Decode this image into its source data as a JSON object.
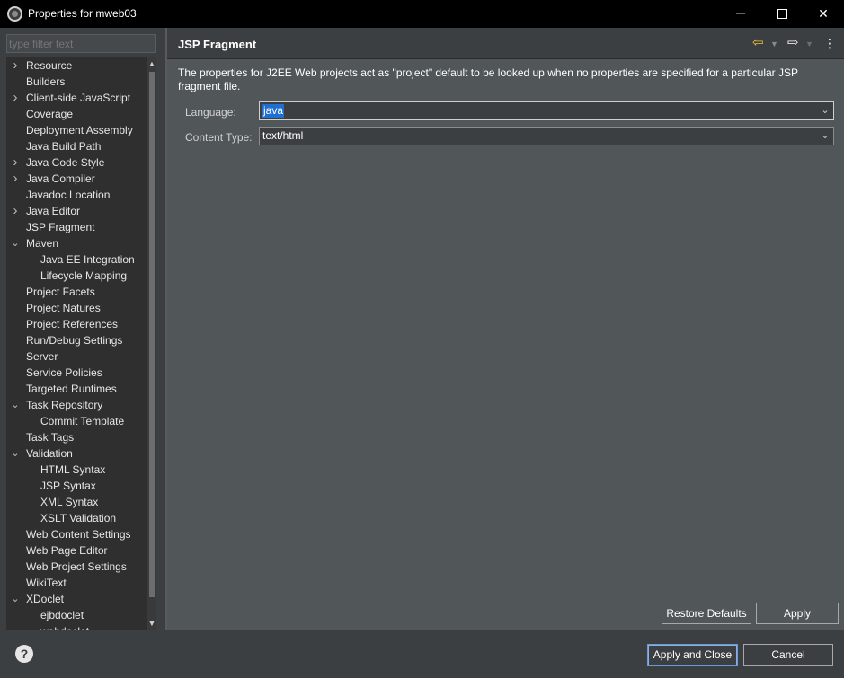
{
  "window": {
    "title": "Properties for mweb03",
    "app_icon": "eclipse-icon",
    "controls": [
      "minimize-icon",
      "maximize-icon",
      "close-icon"
    ]
  },
  "sidebar": {
    "filter_placeholder": "type filter text",
    "items": [
      {
        "label": "Resource",
        "level": 0,
        "toggle": "collapsed"
      },
      {
        "label": "Builders",
        "level": 0,
        "toggle": "none"
      },
      {
        "label": "Client-side JavaScript",
        "level": 0,
        "toggle": "collapsed"
      },
      {
        "label": "Coverage",
        "level": 0,
        "toggle": "none"
      },
      {
        "label": "Deployment Assembly",
        "level": 0,
        "toggle": "none"
      },
      {
        "label": "Java Build Path",
        "level": 0,
        "toggle": "none"
      },
      {
        "label": "Java Code Style",
        "level": 0,
        "toggle": "collapsed"
      },
      {
        "label": "Java Compiler",
        "level": 0,
        "toggle": "collapsed"
      },
      {
        "label": "Javadoc Location",
        "level": 0,
        "toggle": "none"
      },
      {
        "label": "Java Editor",
        "level": 0,
        "toggle": "collapsed"
      },
      {
        "label": "JSP Fragment",
        "level": 0,
        "toggle": "none"
      },
      {
        "label": "Maven",
        "level": 0,
        "toggle": "expanded"
      },
      {
        "label": "Java EE Integration",
        "level": 1,
        "toggle": "none"
      },
      {
        "label": "Lifecycle Mapping",
        "level": 1,
        "toggle": "none"
      },
      {
        "label": "Project Facets",
        "level": 0,
        "toggle": "none"
      },
      {
        "label": "Project Natures",
        "level": 0,
        "toggle": "none"
      },
      {
        "label": "Project References",
        "level": 0,
        "toggle": "none"
      },
      {
        "label": "Run/Debug Settings",
        "level": 0,
        "toggle": "none"
      },
      {
        "label": "Server",
        "level": 0,
        "toggle": "none"
      },
      {
        "label": "Service Policies",
        "level": 0,
        "toggle": "none"
      },
      {
        "label": "Targeted Runtimes",
        "level": 0,
        "toggle": "none"
      },
      {
        "label": "Task Repository",
        "level": 0,
        "toggle": "expanded"
      },
      {
        "label": "Commit Template",
        "level": 1,
        "toggle": "none"
      },
      {
        "label": "Task Tags",
        "level": 0,
        "toggle": "none"
      },
      {
        "label": "Validation",
        "level": 0,
        "toggle": "expanded"
      },
      {
        "label": "HTML Syntax",
        "level": 1,
        "toggle": "none"
      },
      {
        "label": "JSP Syntax",
        "level": 1,
        "toggle": "none"
      },
      {
        "label": "XML Syntax",
        "level": 1,
        "toggle": "none"
      },
      {
        "label": "XSLT Validation",
        "level": 1,
        "toggle": "none"
      },
      {
        "label": "Web Content Settings",
        "level": 0,
        "toggle": "none"
      },
      {
        "label": "Web Page Editor",
        "level": 0,
        "toggle": "none"
      },
      {
        "label": "Web Project Settings",
        "level": 0,
        "toggle": "none"
      },
      {
        "label": "WikiText",
        "level": 0,
        "toggle": "none"
      },
      {
        "label": "XDoclet",
        "level": 0,
        "toggle": "expanded"
      },
      {
        "label": "ejbdoclet",
        "level": 1,
        "toggle": "none"
      },
      {
        "label": "webdoclet",
        "level": 1,
        "toggle": "none"
      }
    ]
  },
  "page": {
    "title": "JSP Fragment",
    "description": "The properties for J2EE Web projects act as \"project\" default to be looked up when no properties are specified for a particular JSP fragment file.",
    "language_label": "Language:",
    "language_value": "java",
    "content_type_label": "Content Type:",
    "content_type_value": "text/html",
    "restore_defaults_label": "Restore Defaults",
    "apply_label": "Apply"
  },
  "footer": {
    "help_icon": "help-icon",
    "apply_close_label": "Apply and Close",
    "cancel_label": "Cancel"
  },
  "colors": {
    "title_bar": "#000000",
    "panel": "#3c3f41",
    "content": "#515658",
    "selection": "#1f6fd1",
    "back_arrow": "#f0c040"
  }
}
